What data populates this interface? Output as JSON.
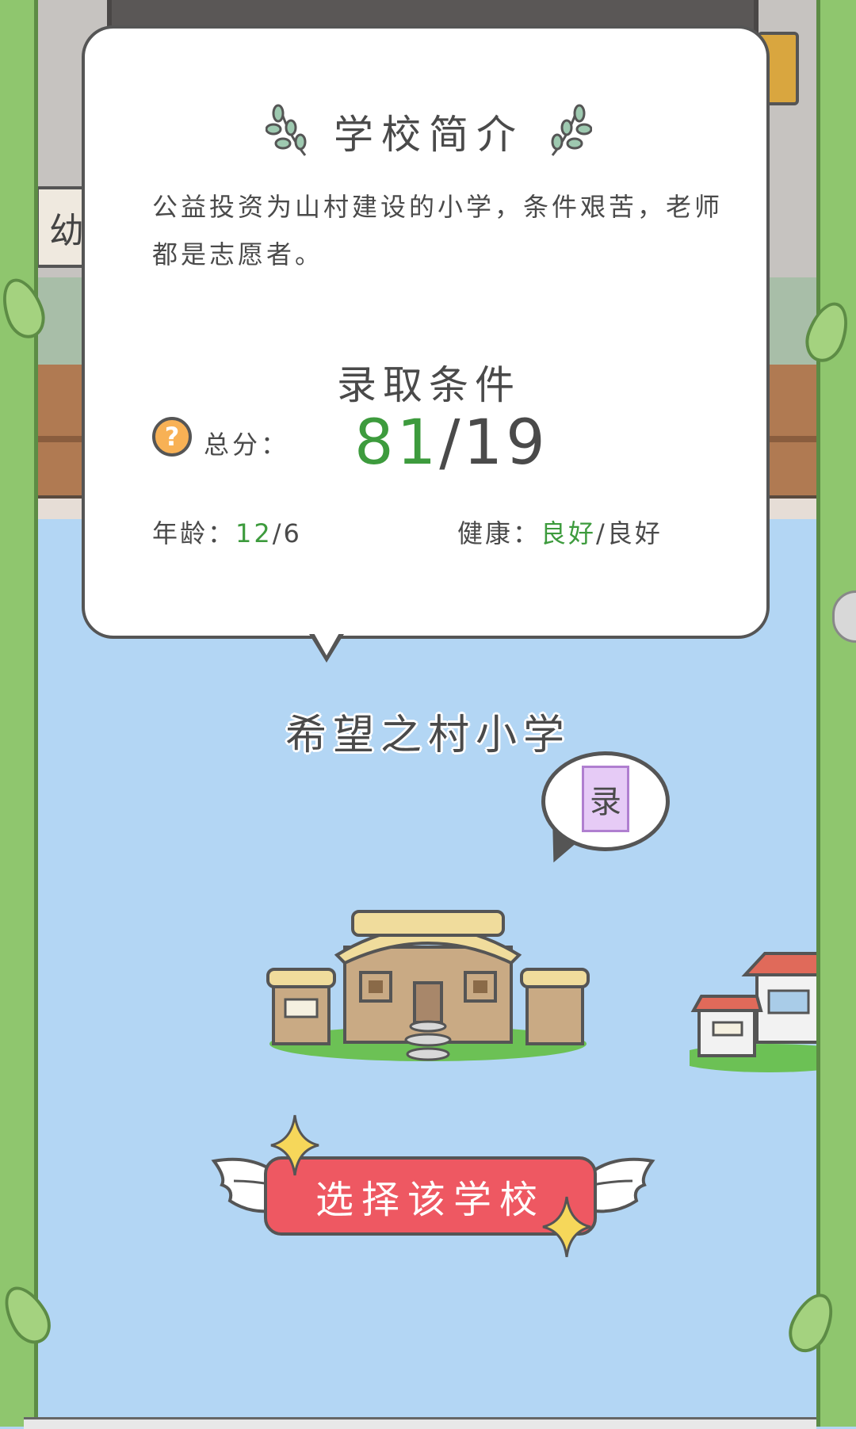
{
  "background": {
    "sign_left_text": "幼"
  },
  "intro": {
    "title": "学校简介",
    "description": "公益投资为山村建设的小学，条件艰苦，老师都是志愿者。"
  },
  "requirements": {
    "title": "录取条件",
    "score_label": "总分：",
    "score_current": "81",
    "score_sep_required": "/19",
    "age_label": "年龄：",
    "age_current": "12",
    "age_required": "/6",
    "health_label": "健康：",
    "health_current": "良好",
    "health_required": "/良好"
  },
  "school": {
    "name": "希望之村小学",
    "admit_badge": "录"
  },
  "actions": {
    "select_label": "选择该学校"
  },
  "colors": {
    "accent_green": "#3d9b3d",
    "button_red": "#ee5862",
    "sky_blue": "#b3d6f4",
    "help_orange": "#f8b155",
    "badge_purple": "#e6cbf6"
  },
  "icons": [
    "help-icon",
    "laurel-icon",
    "sparkle-icon",
    "wing-icon"
  ]
}
